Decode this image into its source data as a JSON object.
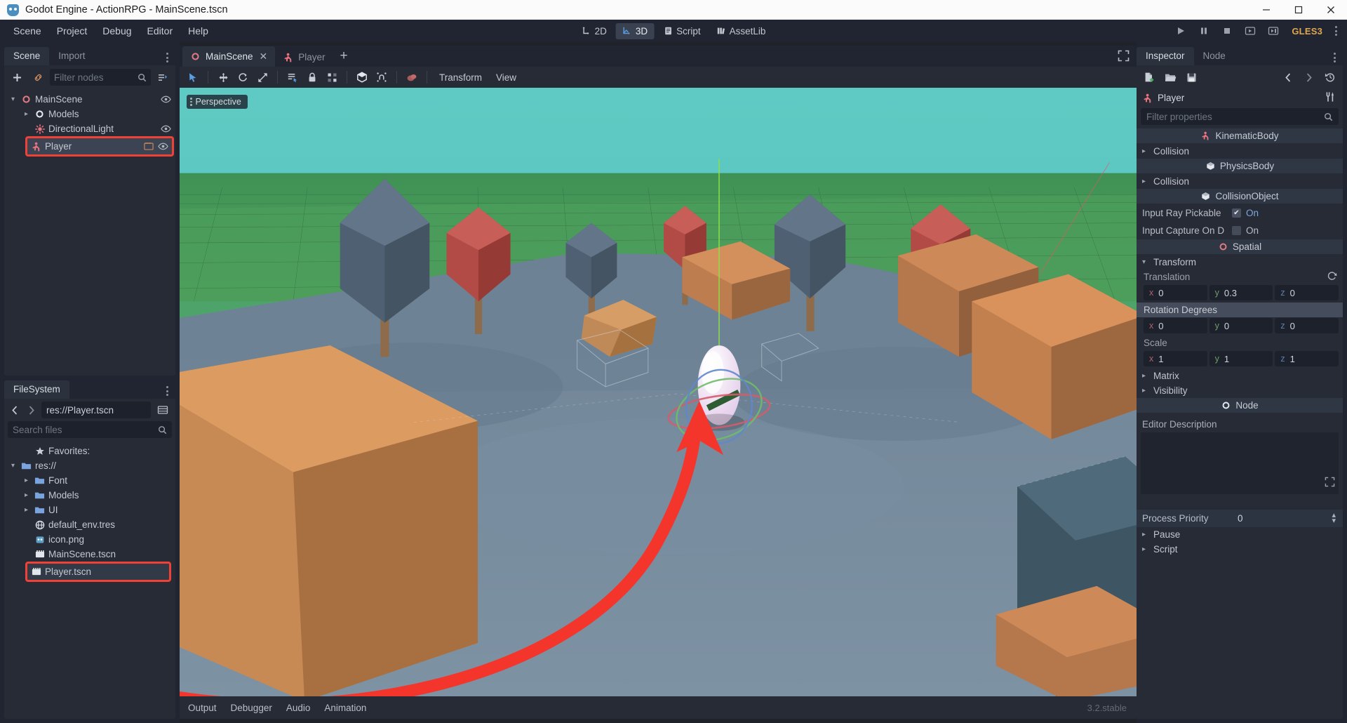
{
  "window": {
    "title": "Godot Engine - ActionRPG - MainScene.tscn",
    "logo_icon": "godot-robot-icon",
    "minimize": "–",
    "maximize": "▢",
    "close": "✕"
  },
  "menubar": {
    "items": [
      "Scene",
      "Project",
      "Debug",
      "Editor",
      "Help"
    ],
    "modes": [
      {
        "label": "2D",
        "icon": "2d-icon",
        "active": false
      },
      {
        "label": "3D",
        "icon": "3d-icon",
        "active": true
      },
      {
        "label": "Script",
        "icon": "script-icon",
        "active": false
      },
      {
        "label": "AssetLib",
        "icon": "assetlib-icon",
        "active": false
      }
    ],
    "right": {
      "play_icon": "play-icon",
      "pause_icon": "pause-icon",
      "stop_icon": "stop-icon",
      "play_scene_icon": "play-scene-icon",
      "play_custom_icon": "play-custom-scene-icon",
      "renderer": "GLES3",
      "menu_icon": "kebab-icon"
    }
  },
  "scene_dock": {
    "tabs": [
      {
        "label": "Scene",
        "active": true
      },
      {
        "label": "Import",
        "active": false
      }
    ],
    "menu_icon": "kebab-icon",
    "toolbar": {
      "add_icon": "plus-icon",
      "instance_icon": "link-icon",
      "filter_placeholder": "Filter nodes",
      "search_icon": "search-icon",
      "tree_menu_icon": "tree-options-icon"
    },
    "tree": [
      {
        "label": "MainScene",
        "icon": "node-spatial-icon",
        "depth": 0,
        "twisty": "down",
        "visible_icon": "eye-icon",
        "selected": false,
        "highlight": false
      },
      {
        "label": "Models",
        "icon": "node-spatial-icon",
        "depth": 1,
        "twisty": "right",
        "visible_icon": "",
        "selected": false,
        "highlight": false
      },
      {
        "label": "DirectionalLight",
        "icon": "light-icon",
        "depth": 1,
        "twisty": "",
        "visible_icon": "eye-icon",
        "selected": false,
        "highlight": false
      },
      {
        "label": "Player",
        "icon": "kinematic-body-icon",
        "depth": 1,
        "twisty": "",
        "visible_icon": "eye-icon",
        "scene_icon": "scene-instance-icon",
        "selected": true,
        "highlight": true
      }
    ]
  },
  "filesystem_dock": {
    "tabs": [
      {
        "label": "FileSystem",
        "active": true
      }
    ],
    "menu_icon": "kebab-icon",
    "nav": {
      "back_icon": "chevron-left-icon",
      "forward_icon": "chevron-right-icon"
    },
    "path": "res://Player.tscn",
    "layout_icon": "split-mode-icon",
    "search_placeholder": "Search files",
    "search_icon": "search-icon",
    "items": [
      {
        "label": "Favorites:",
        "icon": "star-icon",
        "depth": 1,
        "twisty": "",
        "highlight": false
      },
      {
        "label": "res://",
        "icon": "folder-icon",
        "depth": 0,
        "twisty": "down",
        "highlight": false
      },
      {
        "label": "Font",
        "icon": "folder-icon",
        "depth": 1,
        "twisty": "right",
        "highlight": false
      },
      {
        "label": "Models",
        "icon": "folder-icon",
        "depth": 1,
        "twisty": "right",
        "highlight": false
      },
      {
        "label": "UI",
        "icon": "folder-icon",
        "depth": 1,
        "twisty": "right",
        "highlight": false
      },
      {
        "label": "default_env.tres",
        "icon": "environment-icon",
        "depth": 1,
        "twisty": "",
        "highlight": false
      },
      {
        "label": "icon.png",
        "icon": "image-icon",
        "depth": 1,
        "twisty": "",
        "highlight": false
      },
      {
        "label": "MainScene.tscn",
        "icon": "packed-scene-icon",
        "depth": 1,
        "twisty": "",
        "highlight": false
      },
      {
        "label": "Player.tscn",
        "icon": "packed-scene-icon",
        "depth": 1,
        "twisty": "",
        "highlight": true
      }
    ]
  },
  "editor": {
    "scene_tabs": [
      {
        "label": "MainScene",
        "icon": "node-spatial-icon",
        "active": true,
        "closable": true
      },
      {
        "label": "Player",
        "icon": "kinematic-body-icon",
        "active": false,
        "closable": false
      }
    ],
    "add_tab_icon": "plus-icon",
    "expand_icon": "fullscreen-icon",
    "viewport_toolbar": {
      "tools": [
        "select-mode-icon",
        "move-mode-icon",
        "rotate-mode-icon",
        "scale-mode-icon",
        "list-select-icon",
        "lock-icon",
        "group-icon",
        "local-space-icon",
        "snap-icon",
        "environment-icon"
      ],
      "menus": [
        "Transform",
        "View"
      ]
    },
    "perspective_label": "Perspective",
    "bottom_panels": [
      "Output",
      "Debugger",
      "Audio",
      "Animation"
    ],
    "version": "3.2.stable"
  },
  "inspector": {
    "tabs": [
      {
        "label": "Inspector",
        "active": true
      },
      {
        "label": "Node",
        "active": false
      }
    ],
    "menu_icon": "kebab-icon",
    "toolbar": {
      "new_resource_icon": "new-resource-icon",
      "load_icon": "folder-open-icon",
      "save_icon": "save-icon",
      "back_icon": "chevron-left-icon",
      "forward_icon": "chevron-right-icon",
      "history_icon": "history-icon"
    },
    "object_name": "Player",
    "object_icon": "kinematic-body-icon",
    "object_tools_icon": "object-tools-icon",
    "filter_placeholder": "Filter properties",
    "search_icon": "search-icon",
    "rows": [
      {
        "kind": "category",
        "label": "KinematicBody",
        "icon": "kinematic-body-icon"
      },
      {
        "kind": "section",
        "label": "Collision",
        "arrow": "right"
      },
      {
        "kind": "category",
        "label": "PhysicsBody",
        "icon": "cube-icon"
      },
      {
        "kind": "section",
        "label": "Collision",
        "arrow": "right"
      },
      {
        "kind": "category",
        "label": "CollisionObject",
        "icon": "cube-icon"
      },
      {
        "kind": "checkbox",
        "label": "Input Ray Pickable",
        "value": "On",
        "checked": true
      },
      {
        "kind": "checkbox",
        "label": "Input Capture On D",
        "value": "On",
        "checked": false
      },
      {
        "kind": "category",
        "label": "Spatial",
        "icon": "spatial-icon"
      },
      {
        "kind": "section",
        "label": "Transform",
        "arrow": "down"
      },
      {
        "kind": "group",
        "label": "Translation",
        "reset": true,
        "highlight": false
      },
      {
        "kind": "vector",
        "x": "0",
        "y": "0.3",
        "z": "0"
      },
      {
        "kind": "group",
        "label": "Rotation Degrees",
        "reset": false,
        "highlight": true
      },
      {
        "kind": "vector",
        "x": "0",
        "y": "0",
        "z": "0"
      },
      {
        "kind": "group",
        "label": "Scale",
        "reset": false,
        "highlight": false
      },
      {
        "kind": "vector",
        "x": "1",
        "y": "1",
        "z": "1"
      },
      {
        "kind": "section",
        "label": "Matrix",
        "arrow": "right"
      },
      {
        "kind": "section",
        "label": "Visibility",
        "arrow": "right"
      },
      {
        "kind": "category",
        "label": "Node",
        "icon": "spatial-icon"
      }
    ],
    "editor_description_label": "Editor Description",
    "editor_description_value": "",
    "editor_description_resize_icon": "resize-icon",
    "process_priority_label": "Process Priority",
    "process_priority_value": "0",
    "tail_sections": [
      {
        "label": "Pause",
        "arrow": "right"
      },
      {
        "label": "Script",
        "arrow": "right"
      }
    ]
  },
  "annotation": {
    "arrow_color": "#f4352c",
    "highlight_color": "#ef4136",
    "arrow_name": "red-annotation-arrow-player-tscn-to-scene"
  },
  "theme": {
    "bg_dark": "#202531",
    "panel": "#262b36",
    "accent_blue": "#5a81c4",
    "sky": "#55c3bd",
    "ground": "#4a9a57"
  }
}
